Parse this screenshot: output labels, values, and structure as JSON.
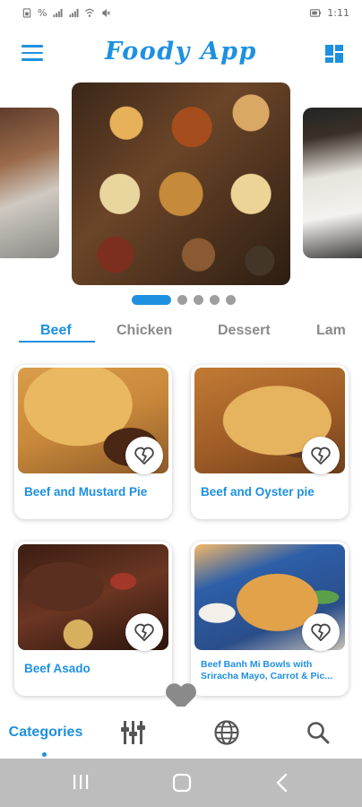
{
  "status_bar": {
    "left_text": "%",
    "battery_text": "",
    "time": "1:11"
  },
  "app_bar": {
    "title": "Foody App",
    "menu_icon": "hamburger-menu-icon",
    "layout_icon": "grid-view-icon"
  },
  "carousel": {
    "slides": [
      "restaurant kitchen",
      "food platter",
      "chef"
    ],
    "active_index": 0,
    "dot_count": 5
  },
  "category_tabs": [
    {
      "label": "Beef",
      "active": true
    },
    {
      "label": "Chicken",
      "active": false
    },
    {
      "label": "Dessert",
      "active": false
    },
    {
      "label": "Lam",
      "active": false
    }
  ],
  "meals": [
    {
      "title": "Beef and Mustard Pie",
      "favorite_icon": "heart-broken-icon"
    },
    {
      "title": "Beef and Oyster pie",
      "favorite_icon": "heart-broken-icon"
    },
    {
      "title": "Beef Asado",
      "favorite_icon": "heart-broken-icon"
    },
    {
      "title": "Beef Banh Mi Bowls with Sriracha Mayo, Carrot & Pic...",
      "favorite_icon": "heart-broken-icon"
    }
  ],
  "bottom_nav": {
    "items": [
      {
        "label": "Categories",
        "icon": "categories-icon",
        "active": true
      },
      {
        "label": "",
        "icon": "ingredients-filter-icon",
        "active": false
      },
      {
        "label": "",
        "icon": "globe-icon",
        "active": false
      },
      {
        "label": "",
        "icon": "search-icon",
        "active": false
      }
    ]
  },
  "colors": {
    "accent": "#1e90e0",
    "inactive_tab": "#8a8a8a",
    "system_nav": "#bdbdbd"
  }
}
